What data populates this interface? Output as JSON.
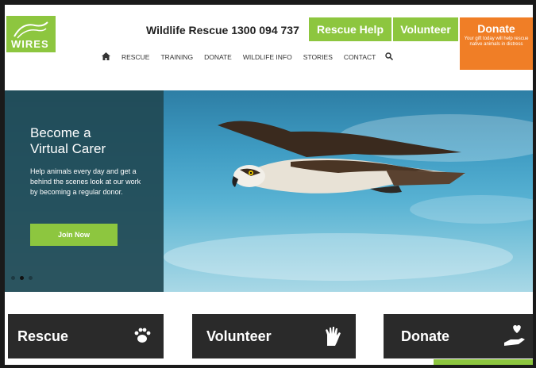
{
  "header": {
    "logo_text": "WIRES",
    "phone": "Wildlife Rescue 1300 094 737",
    "rescue_help_label": "Rescue Help",
    "volunteer_label": "Volunteer",
    "donate": {
      "title": "Donate",
      "subtitle": "Your gift today will help rescue native animals in distress"
    },
    "nav": [
      "RESCUE",
      "TRAINING",
      "DONATE",
      "WILDLIFE INFO",
      "STORIES",
      "CONTACT"
    ],
    "icons": {
      "home": "home-icon",
      "search": "search-icon"
    }
  },
  "hero": {
    "title_line1": "Become a",
    "title_line2": "Virtual Carer",
    "text": "Help animals every day and get a behind the scenes look at our work by becoming a regular donor.",
    "button_label": "Join Now",
    "slides": 3,
    "active_slide": 1
  },
  "tiles": [
    {
      "label": "Rescue",
      "icon": "paw-icon"
    },
    {
      "label": "Volunteer",
      "icon": "hand-icon"
    },
    {
      "label": "Donate",
      "icon": "heart-hand-icon"
    }
  ],
  "colors": {
    "brand_green": "#8dc63f",
    "donate_orange": "#f07e26",
    "panel_teal": "#214954",
    "tile_dark": "#2a2a2a"
  }
}
